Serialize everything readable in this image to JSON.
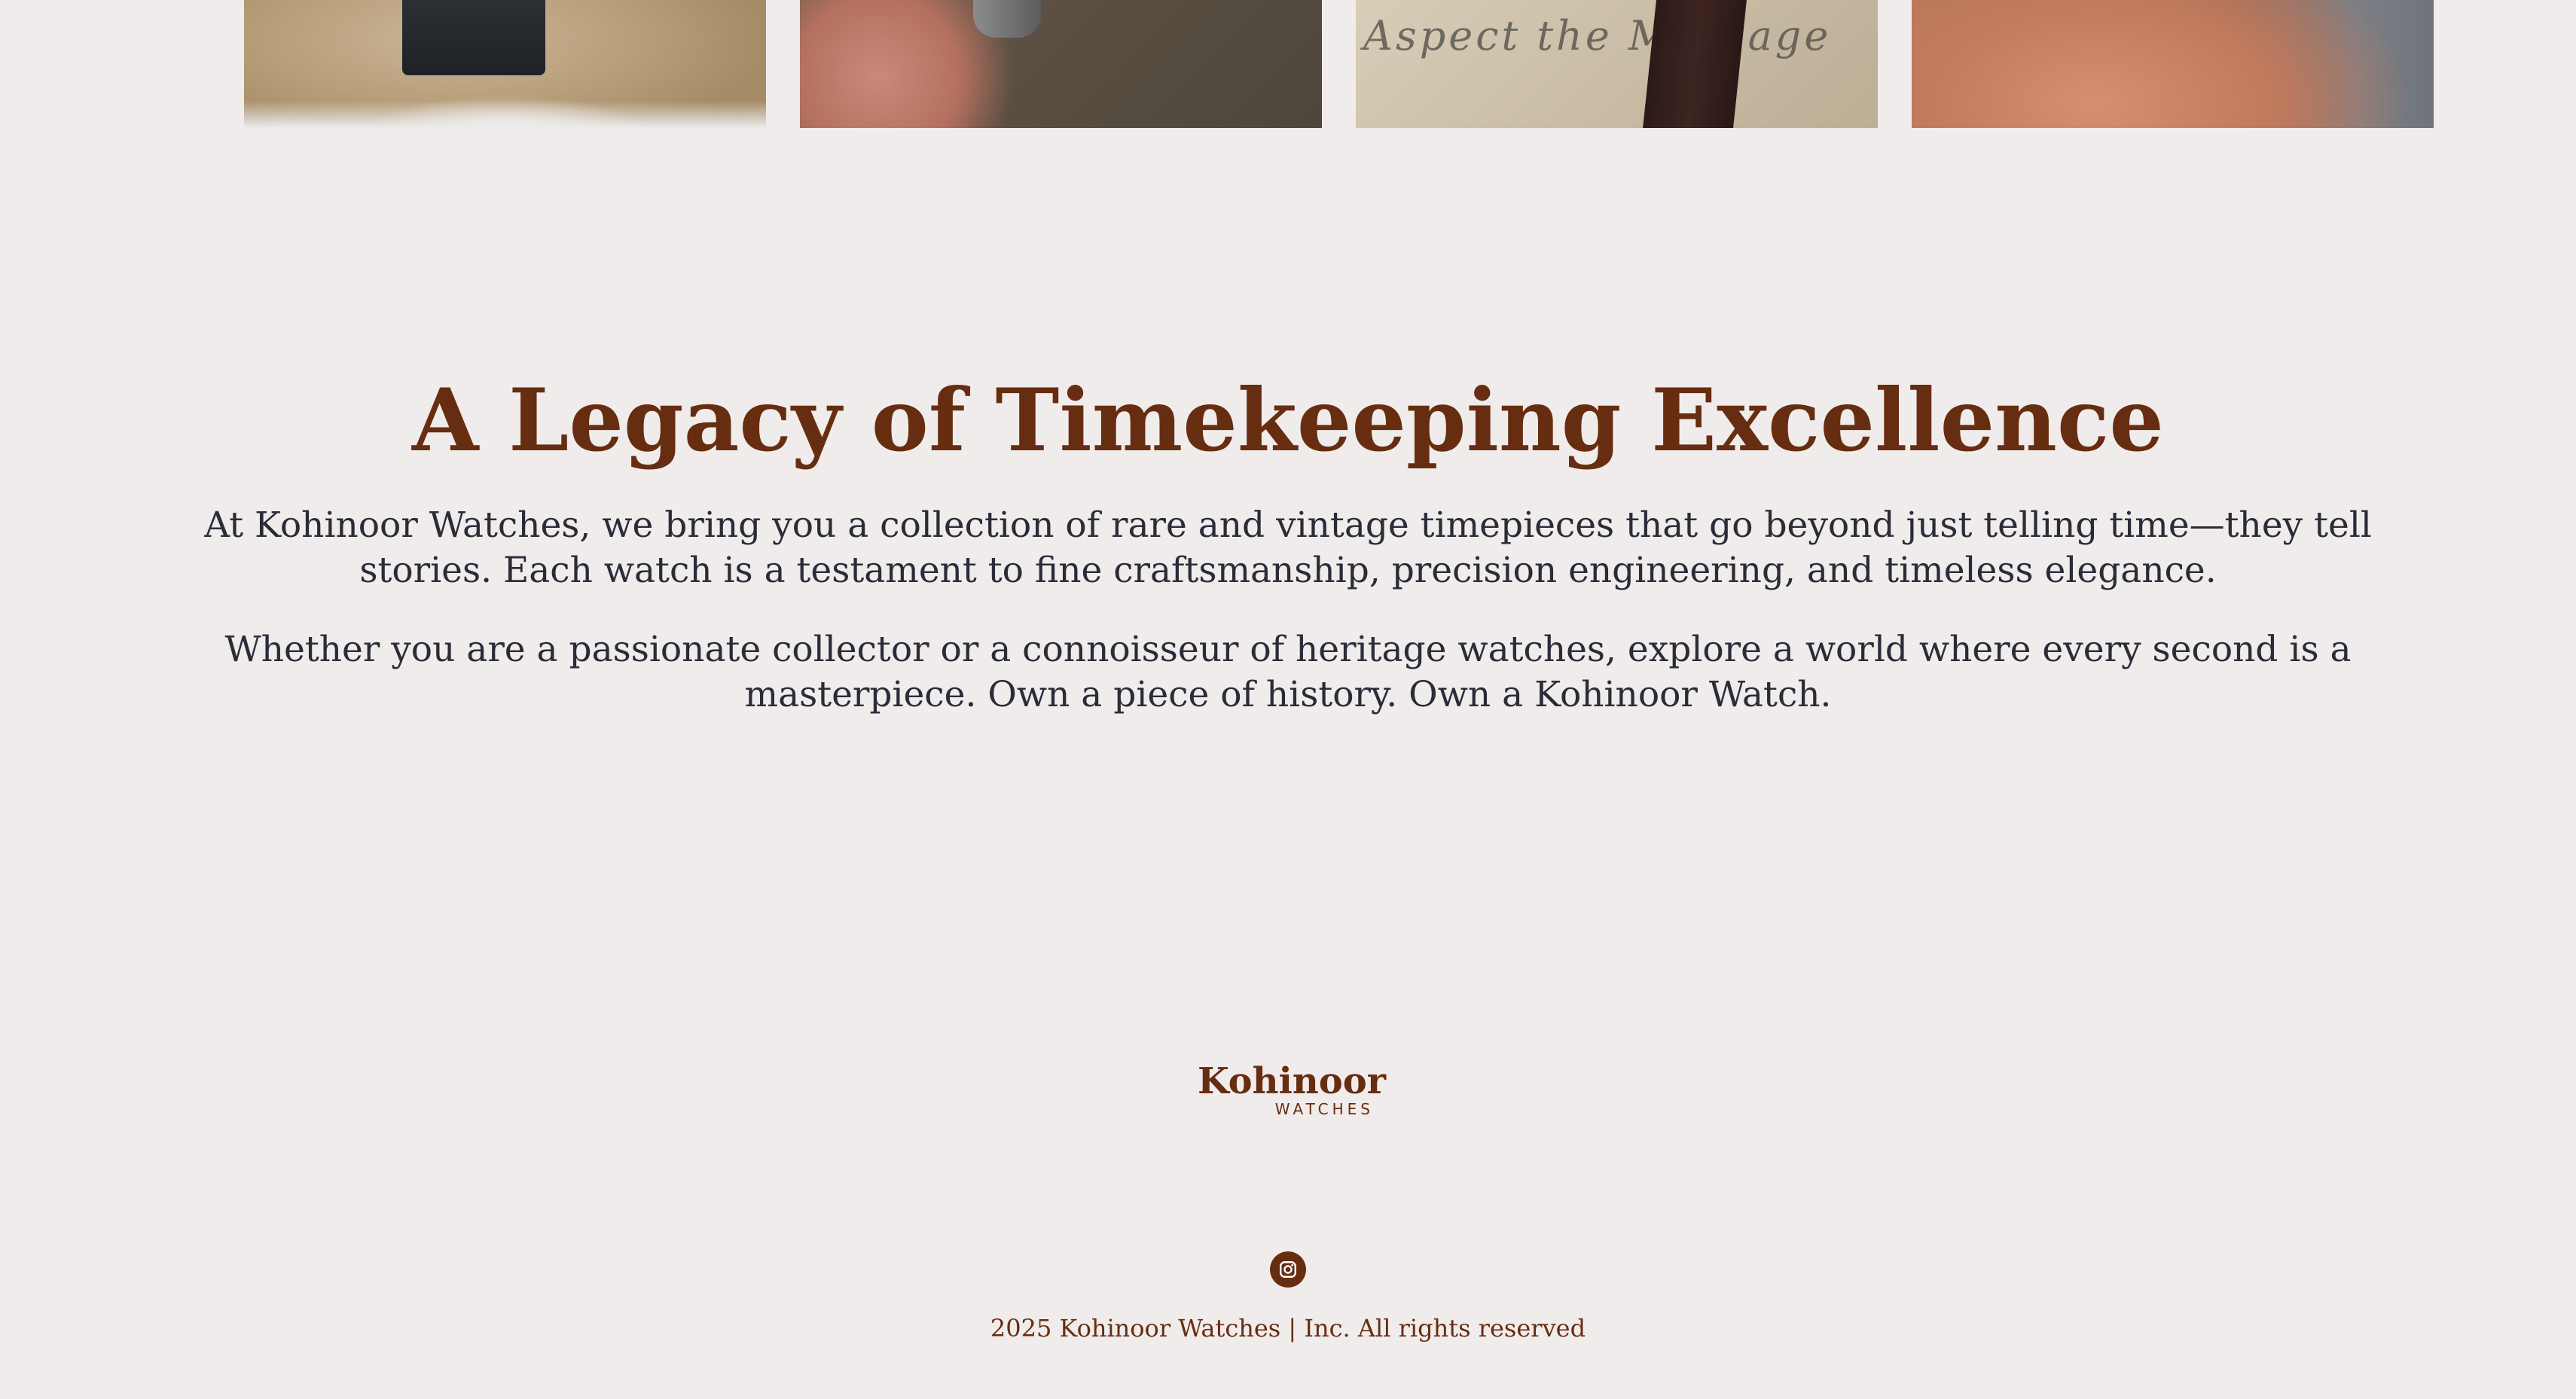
{
  "gallery": {
    "items": [
      {
        "name": "watch-on-cushion"
      },
      {
        "name": "watch-in-hand"
      },
      {
        "name": "watch-on-handwritten-letter",
        "script_text": "Aspect  the  Message"
      },
      {
        "name": "watch-hand-closeup"
      }
    ]
  },
  "legacy": {
    "title": "A Legacy of Timekeeping Excellence",
    "paragraph_1": "At Kohinoor Watches, we bring you a collection of rare and vintage timepieces that go beyond just telling time—they tell stories. Each watch is a testament to fine craftsmanship, precision engineering, and timeless elegance.",
    "paragraph_2": "Whether you are a passionate collector or a connoisseur of heritage watches, explore a world where every second is a masterpiece. Own a piece of history. Own a Kohinoor Watch."
  },
  "footer": {
    "logo_word": "Kohinoor",
    "logo_sub": "WATCHES",
    "social": [
      {
        "icon": "instagram-icon"
      }
    ],
    "copyright": "2025 Kohinoor Watches | Inc. All rights reserved"
  },
  "colors": {
    "background": "#f0ecec",
    "brand": "#672d10",
    "body_text": "#2a2c38"
  }
}
